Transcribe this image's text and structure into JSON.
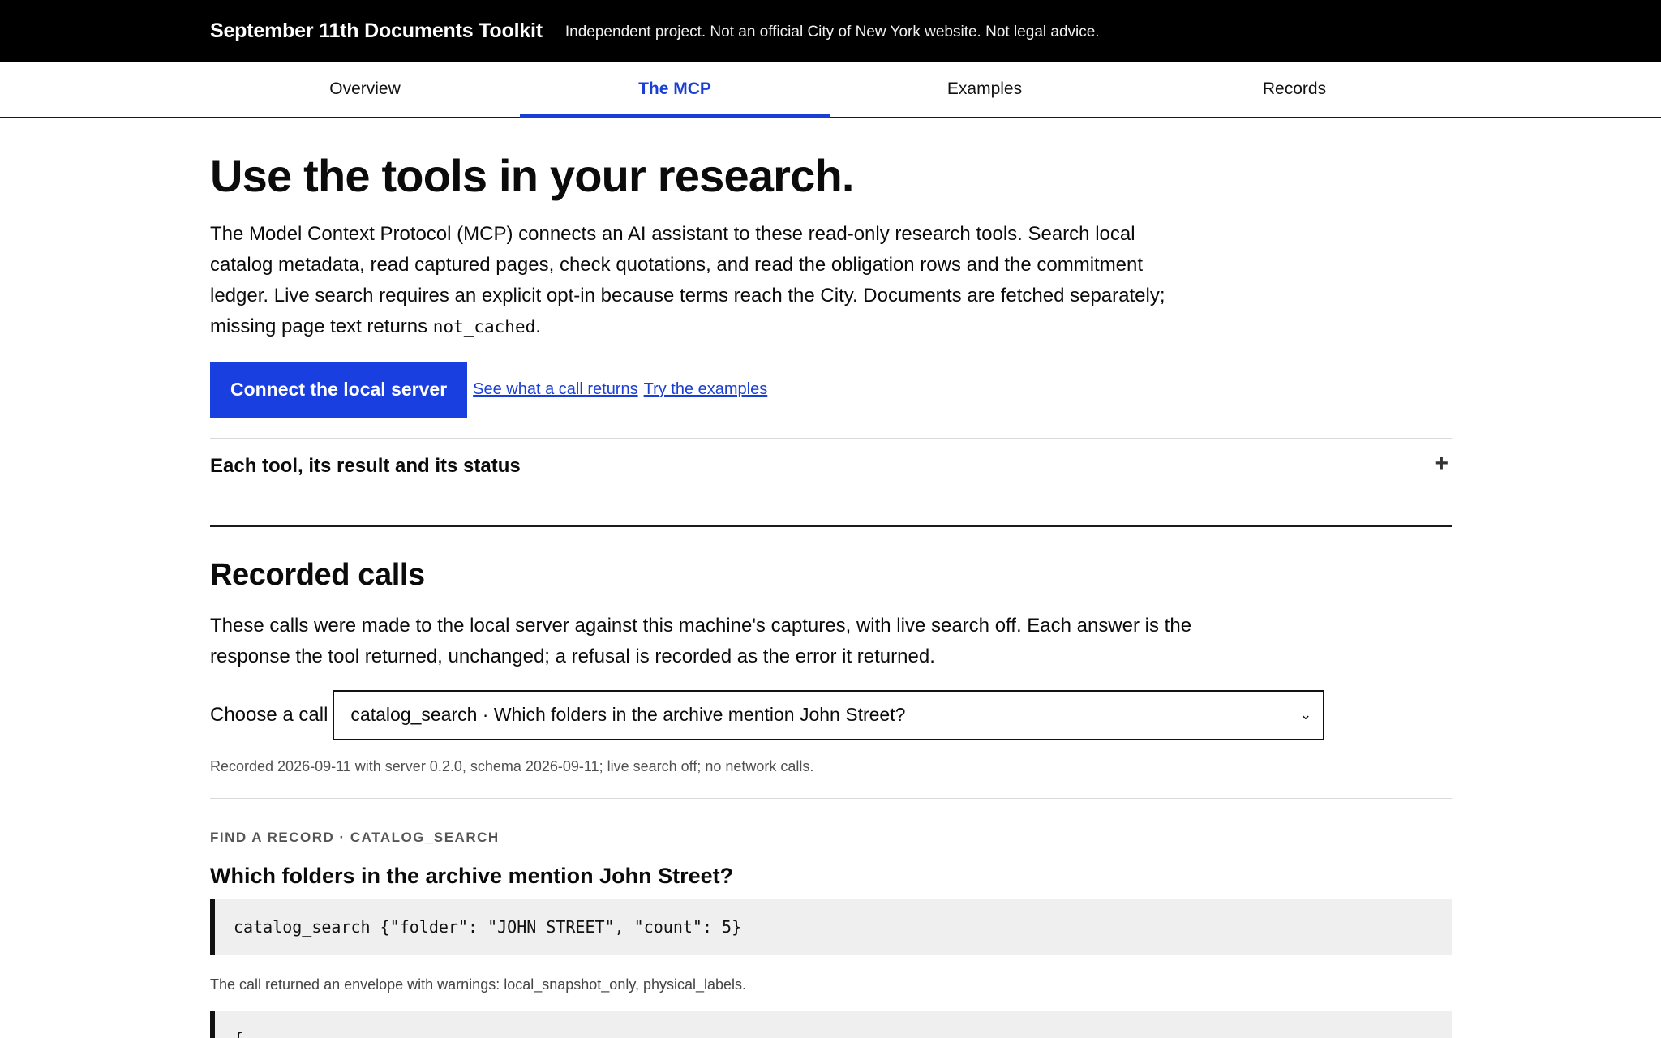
{
  "topbar": {
    "brand": "September 11th Documents Toolkit",
    "disclaimer": "Independent project. Not an official City of New York website. Not legal advice."
  },
  "tabs": [
    {
      "label": "Overview",
      "active": false
    },
    {
      "label": "The MCP",
      "active": true
    },
    {
      "label": "Examples",
      "active": false
    },
    {
      "label": "Records",
      "active": false
    }
  ],
  "hero": {
    "title": "Use the tools in your research.",
    "intro_text": "The Model Context Protocol (MCP) connects an AI assistant to these read-only research tools. Search local catalog metadata, read captured pages, check quotations, and read the obligation rows and the commitment ledger. Live search requires an explicit opt-in because terms reach the City. Documents are fetched separately; missing page text returns ",
    "intro_code": "not_cached",
    "intro_end": "."
  },
  "cta": {
    "primary_label": "Connect the local server",
    "link1": "See what a call returns",
    "link2": "Try the examples"
  },
  "accordion": {
    "title": "Each tool, its result and its status",
    "icon": "plus-icon"
  },
  "recorded": {
    "title": "Recorded calls",
    "desc": "These calls were made to the local server against this machine's captures, with live search off. Each answer is the response the tool returned, unchanged; a refusal is recorded as the error it returned.",
    "choose_label": "Choose a call",
    "selected": "catalog_search · Which folders in the archive mention John Street?",
    "meta": "Recorded 2026-09-11 with server 0.2.0, schema 2026-09-11; live search off; no network calls."
  },
  "call": {
    "eyebrow": "FIND A RECORD · CATALOG_SEARCH",
    "title": "Which folders in the archive mention John Street?",
    "code": "catalog_search {\"folder\": \"JOHN STREET\", \"count\": 5}",
    "result_note": "The call returned an envelope with warnings: local_snapshot_only, physical_labels.",
    "response_start": "{"
  },
  "colors": {
    "accent": "#1a3fd6",
    "button": "#1a3fe0",
    "topbar": "#000000",
    "code_bg": "#efefef"
  }
}
